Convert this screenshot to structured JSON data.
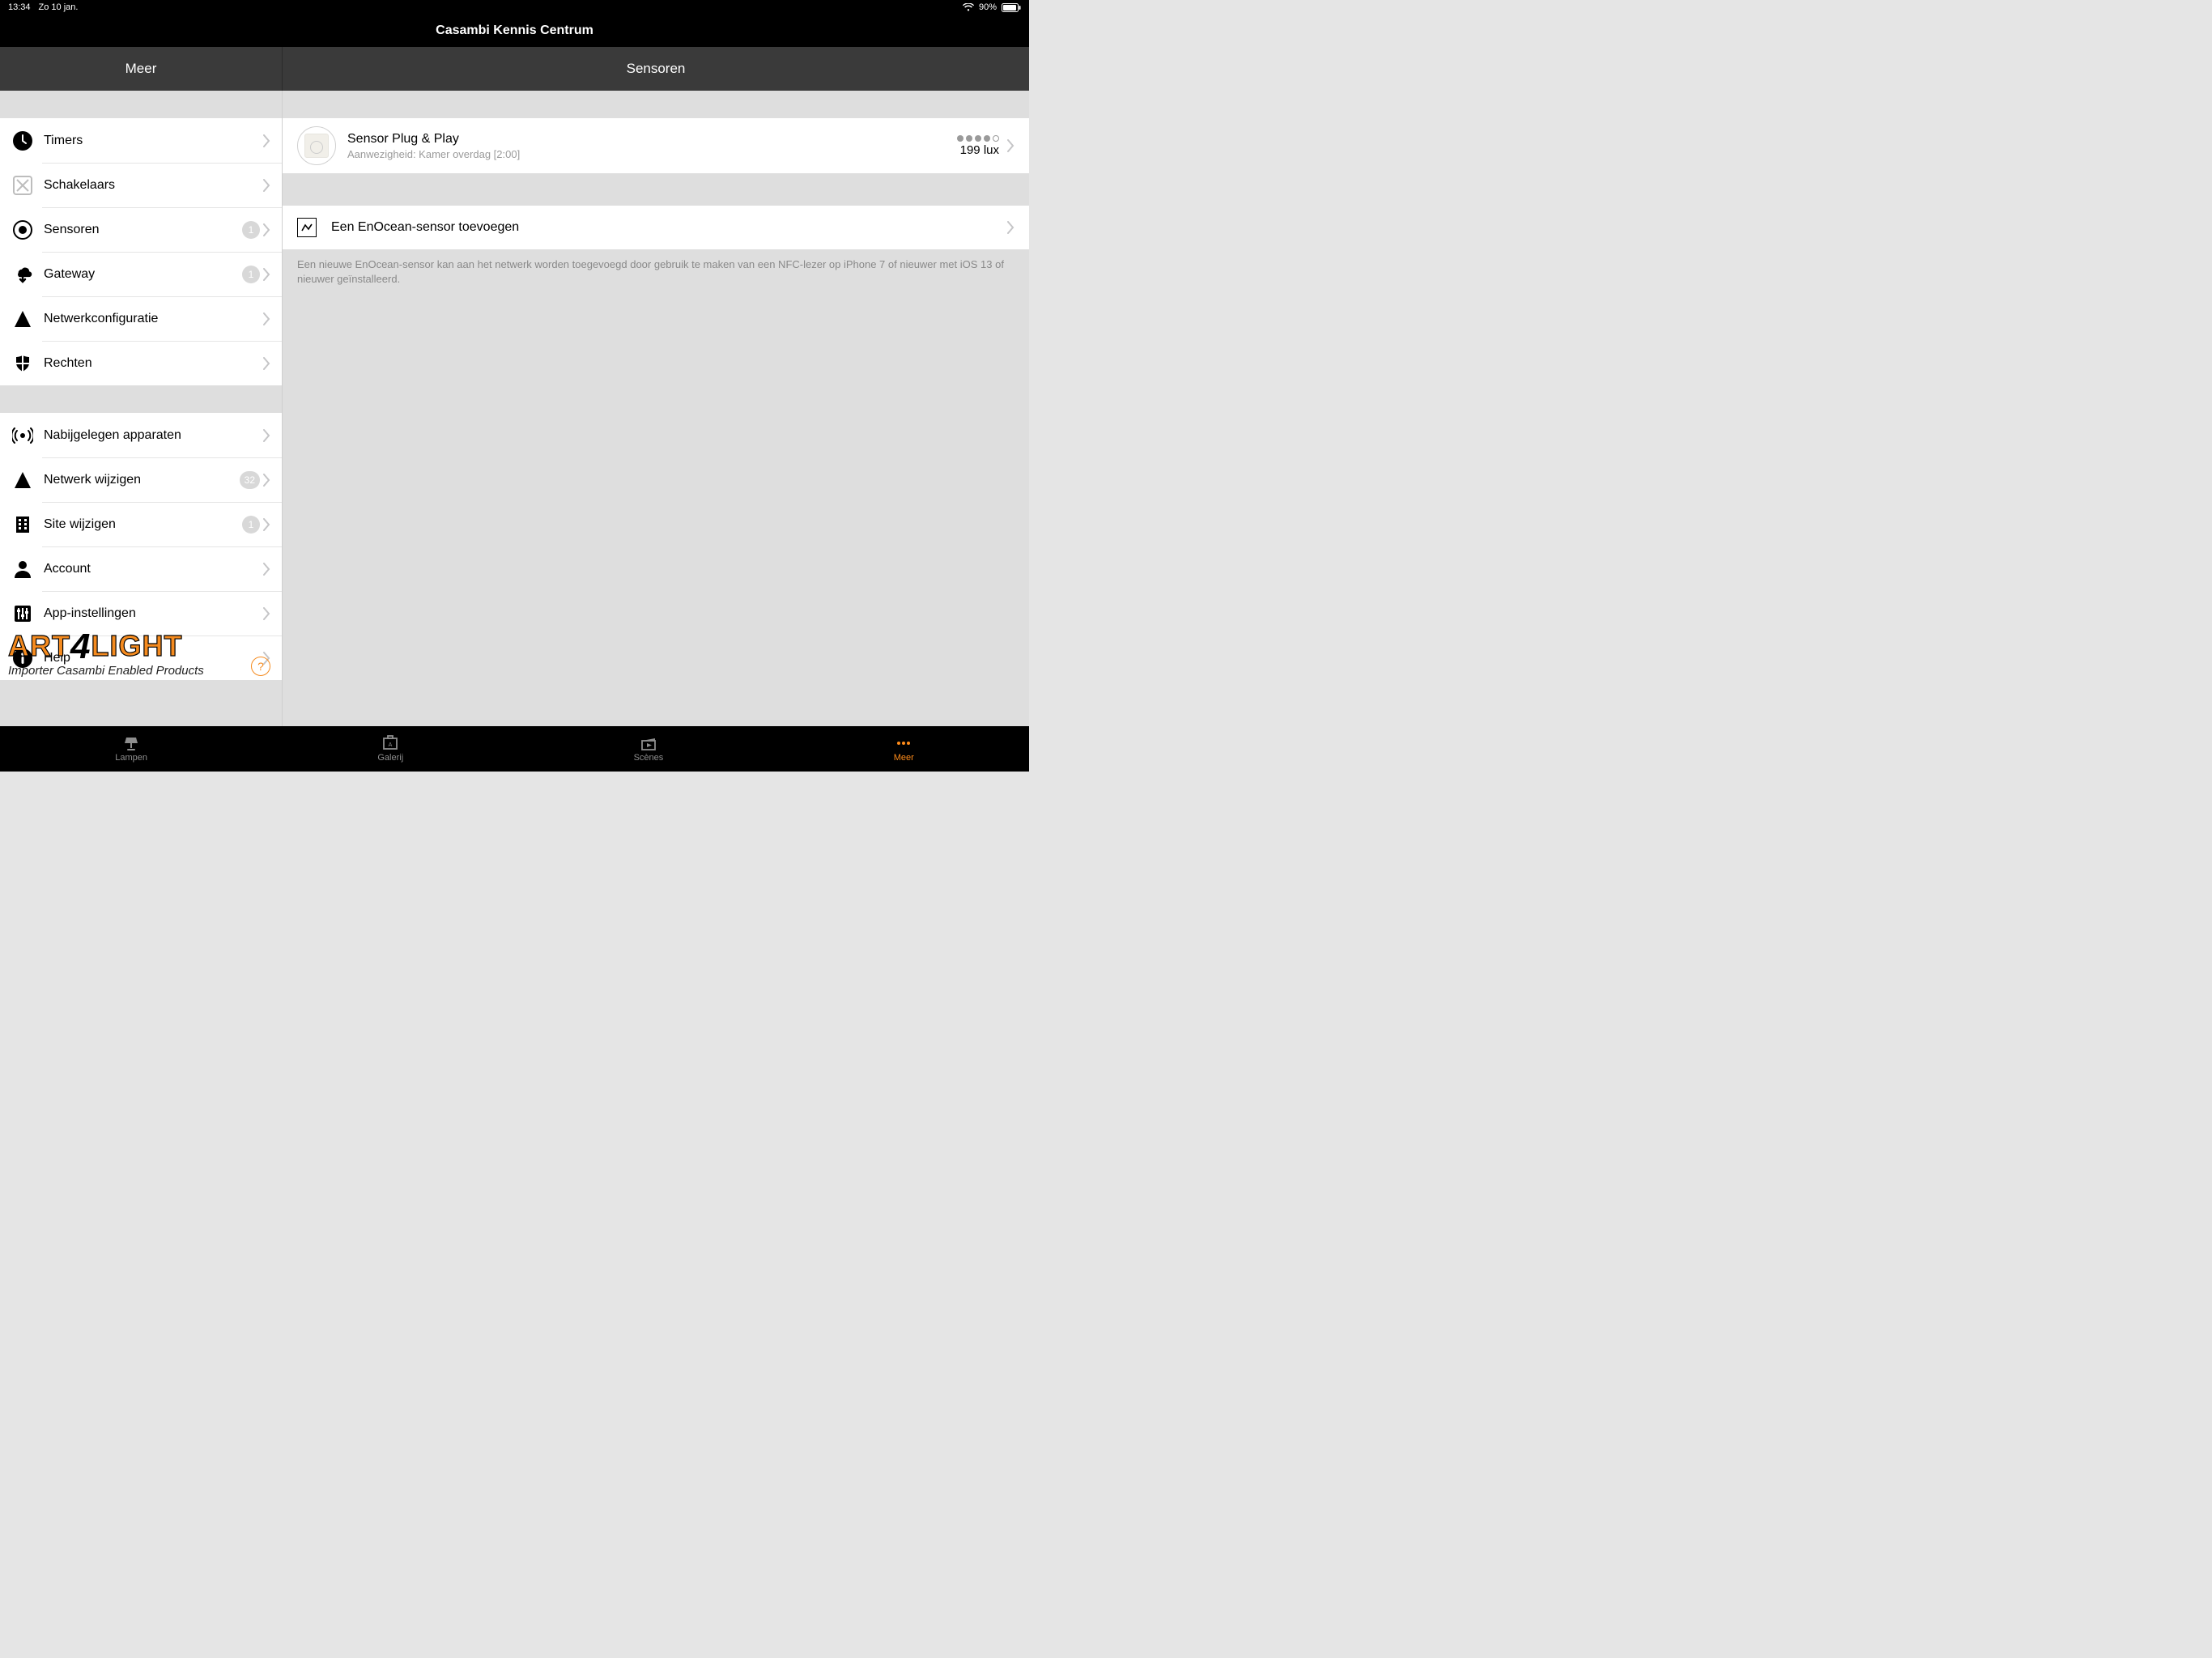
{
  "status": {
    "time": "13:34",
    "date": "Zo 10 jan.",
    "battery": "90%"
  },
  "title": "Casambi Kennis Centrum",
  "sidebar": {
    "header": "Meer",
    "group1": [
      {
        "label": "Timers",
        "icon": "clock"
      },
      {
        "label": "Schakelaars",
        "icon": "switch"
      },
      {
        "label": "Sensoren",
        "icon": "target",
        "badge": "1"
      },
      {
        "label": "Gateway",
        "icon": "cloud-arrow",
        "badge": "1"
      },
      {
        "label": "Netwerkconfiguratie",
        "icon": "triangle"
      },
      {
        "label": "Rechten",
        "icon": "shield"
      }
    ],
    "group2": [
      {
        "label": "Nabijgelegen apparaten",
        "icon": "broadcast"
      },
      {
        "label": "Netwerk wijzigen",
        "icon": "triangle",
        "badge": "32"
      },
      {
        "label": "Site wijzigen",
        "icon": "building",
        "badge": "1"
      },
      {
        "label": "Account",
        "icon": "person"
      },
      {
        "label": "App-instellingen",
        "icon": "sliders"
      },
      {
        "label": "Help",
        "icon": "info"
      }
    ]
  },
  "main": {
    "header": "Sensoren",
    "sensor": {
      "title": "Sensor Plug & Play",
      "subtitle": "Aanwezigheid: Kamer overdag [2:00]",
      "lux": "199 lux",
      "signal_filled": 4,
      "signal_total": 5
    },
    "add_row": "Een EnOcean-sensor toevoegen",
    "help_text": "Een nieuwe EnOcean-sensor kan aan het netwerk worden toegevoegd door gebruik te maken van een NFC-lezer op iPhone 7 of nieuwer met iOS 13 of nieuwer geïnstalleerd."
  },
  "tabs": [
    {
      "label": "Lampen",
      "icon": "lamp"
    },
    {
      "label": "Galerij",
      "icon": "gallery"
    },
    {
      "label": "Scènes",
      "icon": "clapper"
    },
    {
      "label": "Meer",
      "icon": "more",
      "active": true
    }
  ],
  "brand": {
    "art": "ART",
    "four": "4",
    "light": "LIGHT",
    "tagline": "Importer Casambi Enabled Products"
  }
}
